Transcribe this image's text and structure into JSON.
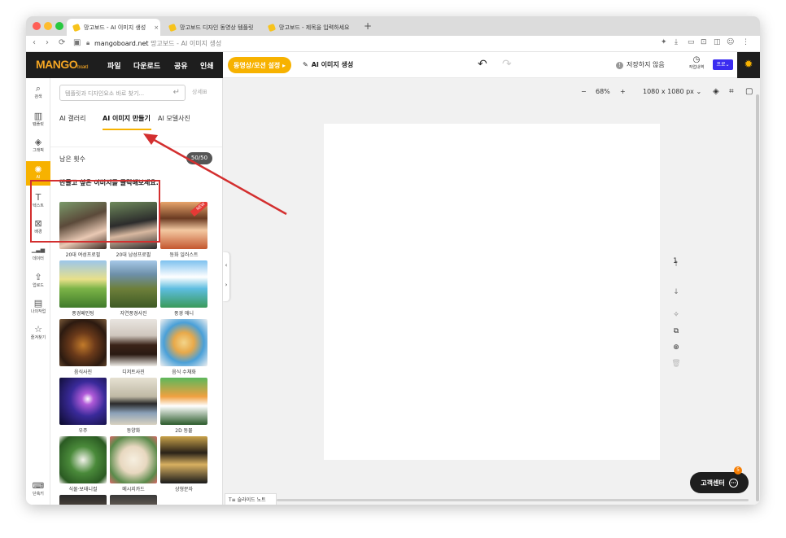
{
  "browser": {
    "tabs": [
      {
        "label": "망고보드 - AI 이미지 생성",
        "active": true
      },
      {
        "label": "망고보드 디자인 동영상 템플릿",
        "active": false
      },
      {
        "label": "망고보드 - 제목을 입력하세요",
        "active": false
      }
    ],
    "new_tab": "+",
    "url_domain": "mangoboard.net",
    "url_title": "망고보드 - AI 이미지 생성"
  },
  "appbar": {
    "logo": "MANGO",
    "logo_sub": "board",
    "menu": [
      "파일",
      "다운로드",
      "공유",
      "인쇄"
    ],
    "motion_button": "동영상/모션 설정 ▸",
    "doc_title": "AI 이미지 생성",
    "save_state": "저장하지 않음",
    "history_label": "작업내역",
    "pro_label": "프로⌄",
    "colors": {
      "accent": "#f7b200",
      "dark": "#1e1e1e",
      "pro": "#3b2cf0"
    }
  },
  "rail": {
    "items": [
      {
        "label": "검색",
        "icon": "search-icon",
        "glyph": "⌕"
      },
      {
        "label": "템플릿",
        "icon": "template-icon",
        "glyph": "▥"
      },
      {
        "label": "그래픽",
        "icon": "graphic-icon",
        "glyph": "◈"
      },
      {
        "label": "AI",
        "icon": "ai-icon",
        "glyph": "✺"
      },
      {
        "label": "텍스트",
        "icon": "text-icon",
        "glyph": "T"
      },
      {
        "label": "배경",
        "icon": "background-icon",
        "glyph": "⊠"
      },
      {
        "label": "데이터",
        "icon": "data-chart-icon",
        "glyph": "▁▃▅"
      },
      {
        "label": "업로드",
        "icon": "upload-icon",
        "glyph": "⇪"
      },
      {
        "label": "나의작업",
        "icon": "my-work-icon",
        "glyph": "▤"
      },
      {
        "label": "즐겨찾기",
        "icon": "star-icon",
        "glyph": "☆"
      }
    ],
    "shortcut_label": "단축키"
  },
  "panel": {
    "search_placeholder": "템플릿과 디자인요소 바로 찾기...",
    "search_enter": "↵",
    "detail_label": "상세⊞",
    "subtabs": [
      "AI 갤러리",
      "AI 이미지 만들기",
      "AI 모델사진"
    ],
    "remain_label": "남은 횟수",
    "remain_badge": "50/50",
    "hint": "만들고 싶은 이미지를 클릭해보세요.",
    "new_tag": "NEW",
    "items": [
      {
        "label": "20대 여성프로필"
      },
      {
        "label": "20대 남성프로필"
      },
      {
        "label": "동화 일러스트"
      },
      {
        "label": "풍경페인팅"
      },
      {
        "label": "자연풍경사진"
      },
      {
        "label": "풍경 애니"
      },
      {
        "label": "음식사진"
      },
      {
        "label": "디저트사진"
      },
      {
        "label": "음식 수채화"
      },
      {
        "label": "우주"
      },
      {
        "label": "동양화"
      },
      {
        "label": "2D 동물"
      },
      {
        "label": "식물·보태니컬"
      },
      {
        "label": "메시지카드"
      },
      {
        "label": "상형문자"
      },
      {
        "label": ""
      },
      {
        "label": ""
      }
    ]
  },
  "workspace": {
    "zoom_minus": "−",
    "zoom": "68%",
    "zoom_plus": "+",
    "size": "1080 x 1080 px ⌄",
    "page_number": "1",
    "notes_label": "슬라이드 노트",
    "support_label": "고객센터",
    "support_badge": "5"
  }
}
